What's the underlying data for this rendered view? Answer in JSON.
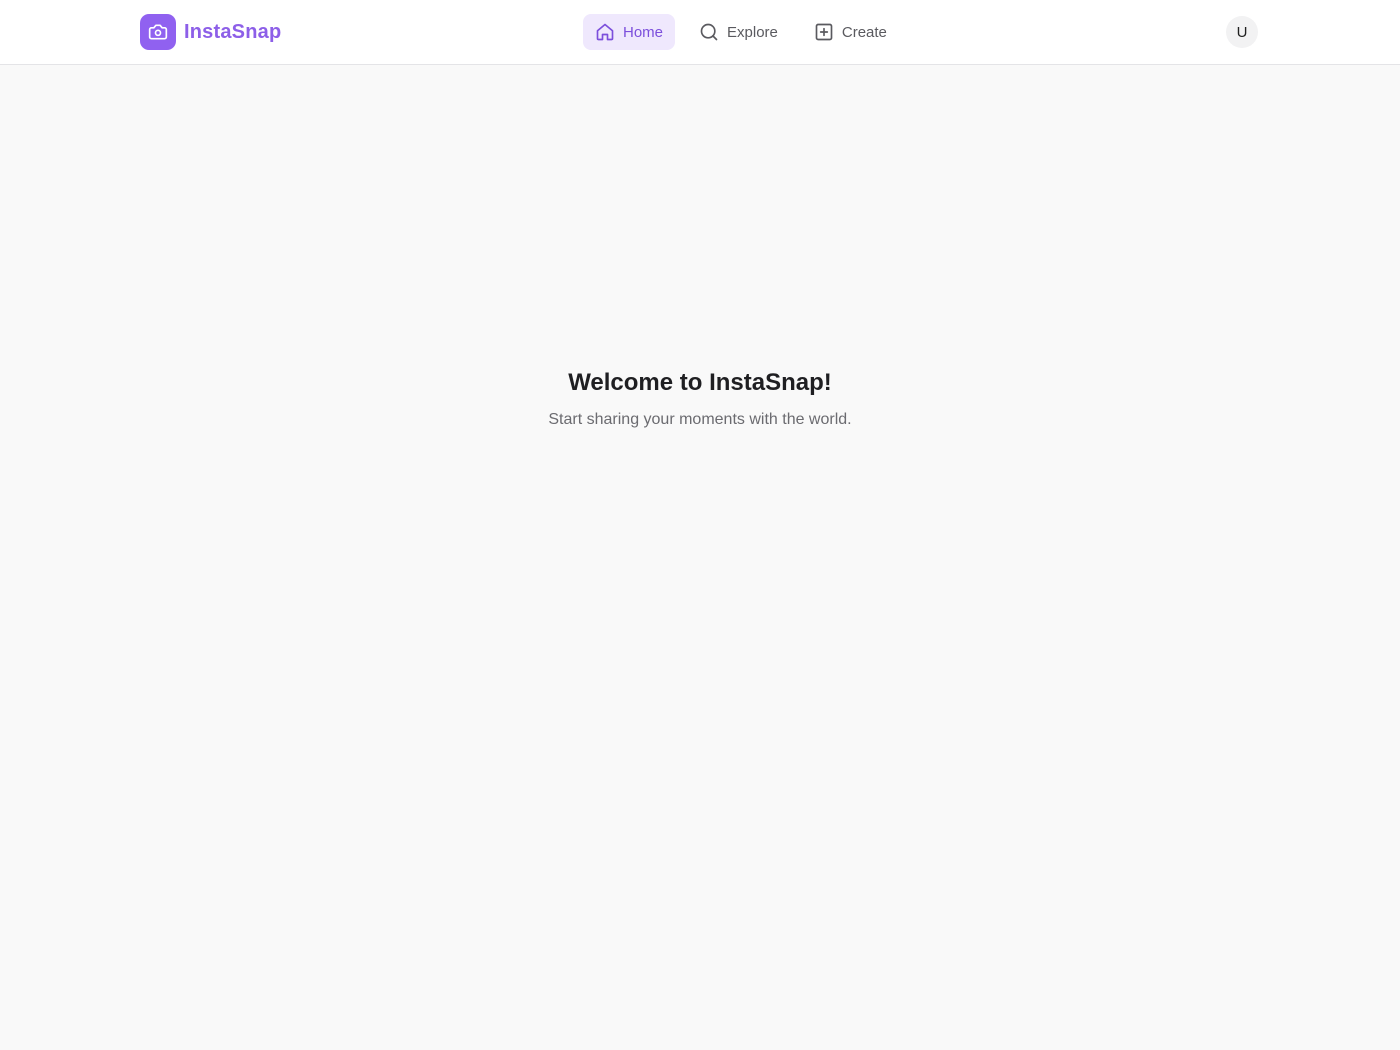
{
  "app": {
    "name": "InstaSnap",
    "logo_icon": "camera-icon",
    "brand_color": "#9061f0"
  },
  "nav": {
    "items": [
      {
        "label": "Home",
        "icon": "home-icon",
        "active": true
      },
      {
        "label": "Explore",
        "icon": "search-icon",
        "active": false
      },
      {
        "label": "Create",
        "icon": "plus-square-icon",
        "active": false
      }
    ]
  },
  "user": {
    "avatar_initial": "U"
  },
  "main": {
    "title": "Welcome to InstaSnap!",
    "subtitle": "Start sharing your moments with the world."
  }
}
